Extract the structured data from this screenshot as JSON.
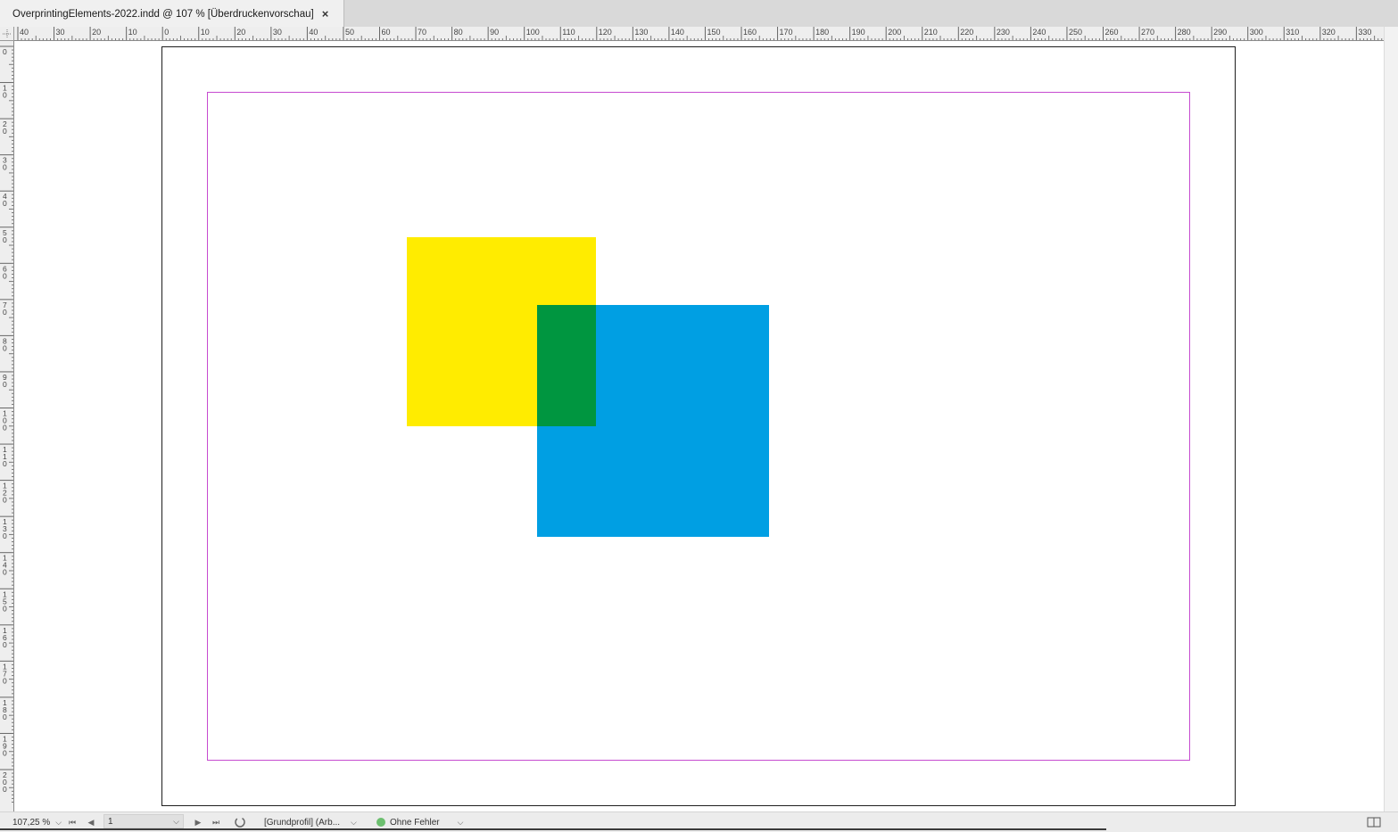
{
  "document_tab": {
    "title": "OverprintingElements-2022.indd @ 107 % [Überdruckenvorschau]",
    "close_symbol": "×"
  },
  "rulers": {
    "horizontal_labels": [
      "40",
      "30",
      "20",
      "10",
      "0",
      "10",
      "20",
      "30",
      "40",
      "50",
      "60",
      "70",
      "80",
      "90",
      "100",
      "110",
      "120",
      "130",
      "140",
      "150",
      "160",
      "170",
      "180",
      "190",
      "200",
      "210",
      "220",
      "230",
      "240",
      "250",
      "260",
      "270",
      "280",
      "290",
      "300",
      "310",
      "320",
      "330"
    ],
    "vertical_labels": [
      "0",
      "10",
      "20",
      "30",
      "40",
      "50",
      "60",
      "70",
      "80",
      "90",
      "100",
      "110",
      "120",
      "130",
      "140",
      "150",
      "160",
      "170",
      "180",
      "190",
      "200"
    ]
  },
  "artwork": {
    "yellow_color": "#ffec00",
    "cyan_color": "#009fe3",
    "overlap_color": "#009640",
    "margin_guide_color": "#c64bd0"
  },
  "status_bar": {
    "zoom_value": "107,25 %",
    "page_number": "1",
    "preflight_profile": "[Grundprofil] (Arb...",
    "preflight_status": "Ohne Fehler",
    "preflight_status_color": "#6cbf6f"
  }
}
